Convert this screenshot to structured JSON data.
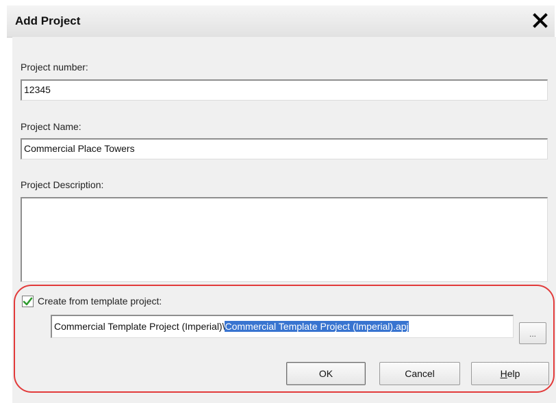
{
  "dialog": {
    "title": "Add Project"
  },
  "fields": {
    "project_number_label": "Project number:",
    "project_number_value": "12345",
    "project_name_label": "Project Name:",
    "project_name_value": "Commercial Place Towers",
    "project_description_label": "Project Description:",
    "project_description_value": ""
  },
  "template": {
    "checkbox_label": "Create from template project:",
    "checked": true,
    "path_prefix": "Commercial Template Project (Imperial)\\",
    "path_selected": "Commercial Template Project (Imperial).apj",
    "browse_label": "..."
  },
  "buttons": {
    "ok": "OK",
    "cancel": "Cancel",
    "help": "Help"
  },
  "colors": {
    "selection": "#3874d0",
    "annotation_oval": "#e23a3a",
    "checkmark": "#2f9a2f"
  }
}
